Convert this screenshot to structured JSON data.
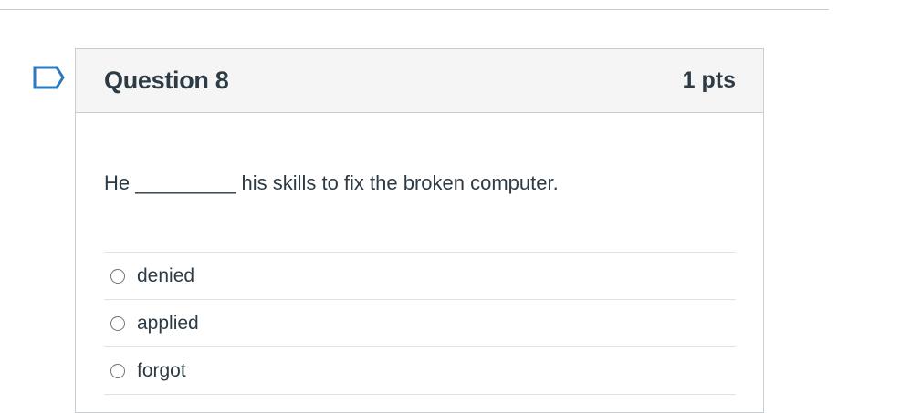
{
  "question": {
    "title": "Question 8",
    "points": "1 pts",
    "text": "He _________ his skills to fix the broken computer.",
    "answers": [
      {
        "label": "denied",
        "selected": false
      },
      {
        "label": "applied",
        "selected": false
      },
      {
        "label": "forgot",
        "selected": false
      }
    ]
  },
  "icons": {
    "flag": "flag-question-icon"
  },
  "colors": {
    "flag_stroke": "#2b7abc",
    "text": "#2d3b45",
    "header_bg": "#f5f5f5",
    "border": "#c7cdd1"
  }
}
